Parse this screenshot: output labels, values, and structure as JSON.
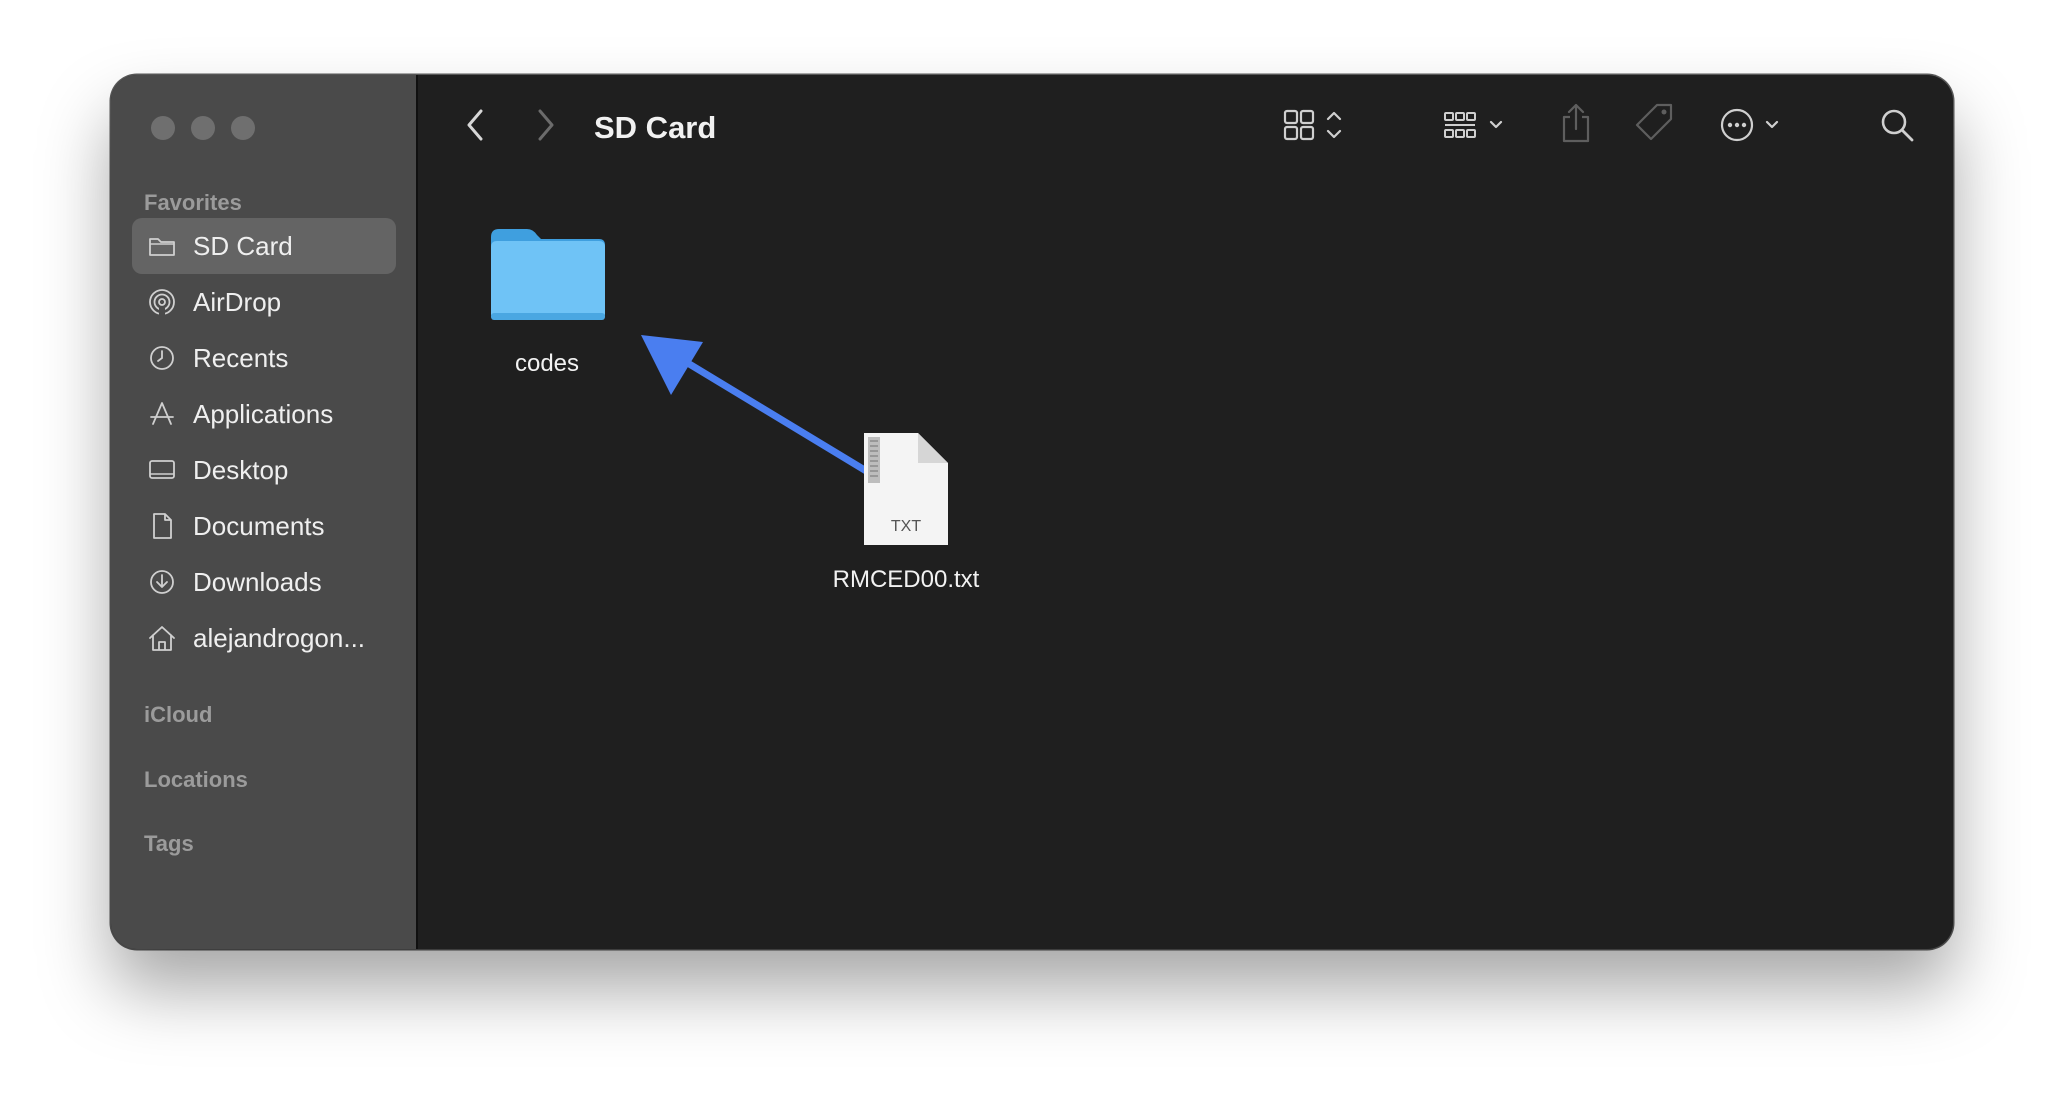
{
  "window": {
    "title": "SD Card"
  },
  "sidebar": {
    "sections": {
      "favorites": "Favorites",
      "icloud": "iCloud",
      "locations": "Locations",
      "tags": "Tags"
    },
    "items": [
      {
        "label": "SD Card",
        "icon": "folder-icon",
        "selected": true
      },
      {
        "label": "AirDrop",
        "icon": "airdrop-icon"
      },
      {
        "label": "Recents",
        "icon": "clock-icon"
      },
      {
        "label": "Applications",
        "icon": "applications-icon"
      },
      {
        "label": "Desktop",
        "icon": "desktop-icon"
      },
      {
        "label": "Documents",
        "icon": "document-icon"
      },
      {
        "label": "Downloads",
        "icon": "download-icon"
      },
      {
        "label": "alejandrogon...",
        "icon": "home-icon"
      }
    ]
  },
  "toolbar": {
    "back": "chevron-left-icon",
    "forward": "chevron-right-icon",
    "view": "icon-grid-icon",
    "group": "group-icon",
    "share": "share-icon",
    "tag": "tag-icon",
    "more": "ellipsis-circle-icon",
    "search": "search-icon"
  },
  "files": [
    {
      "name": "codes",
      "type": "folder"
    },
    {
      "name": "RMCED00.txt",
      "type": "txt",
      "badge": "TXT"
    }
  ],
  "annotation": {
    "arrow_color": "#4a7ef0"
  },
  "colors": {
    "folder": "#6fc3f6",
    "sidebar_bg": "#4a4a4a",
    "content_bg": "#1f1f1f"
  }
}
